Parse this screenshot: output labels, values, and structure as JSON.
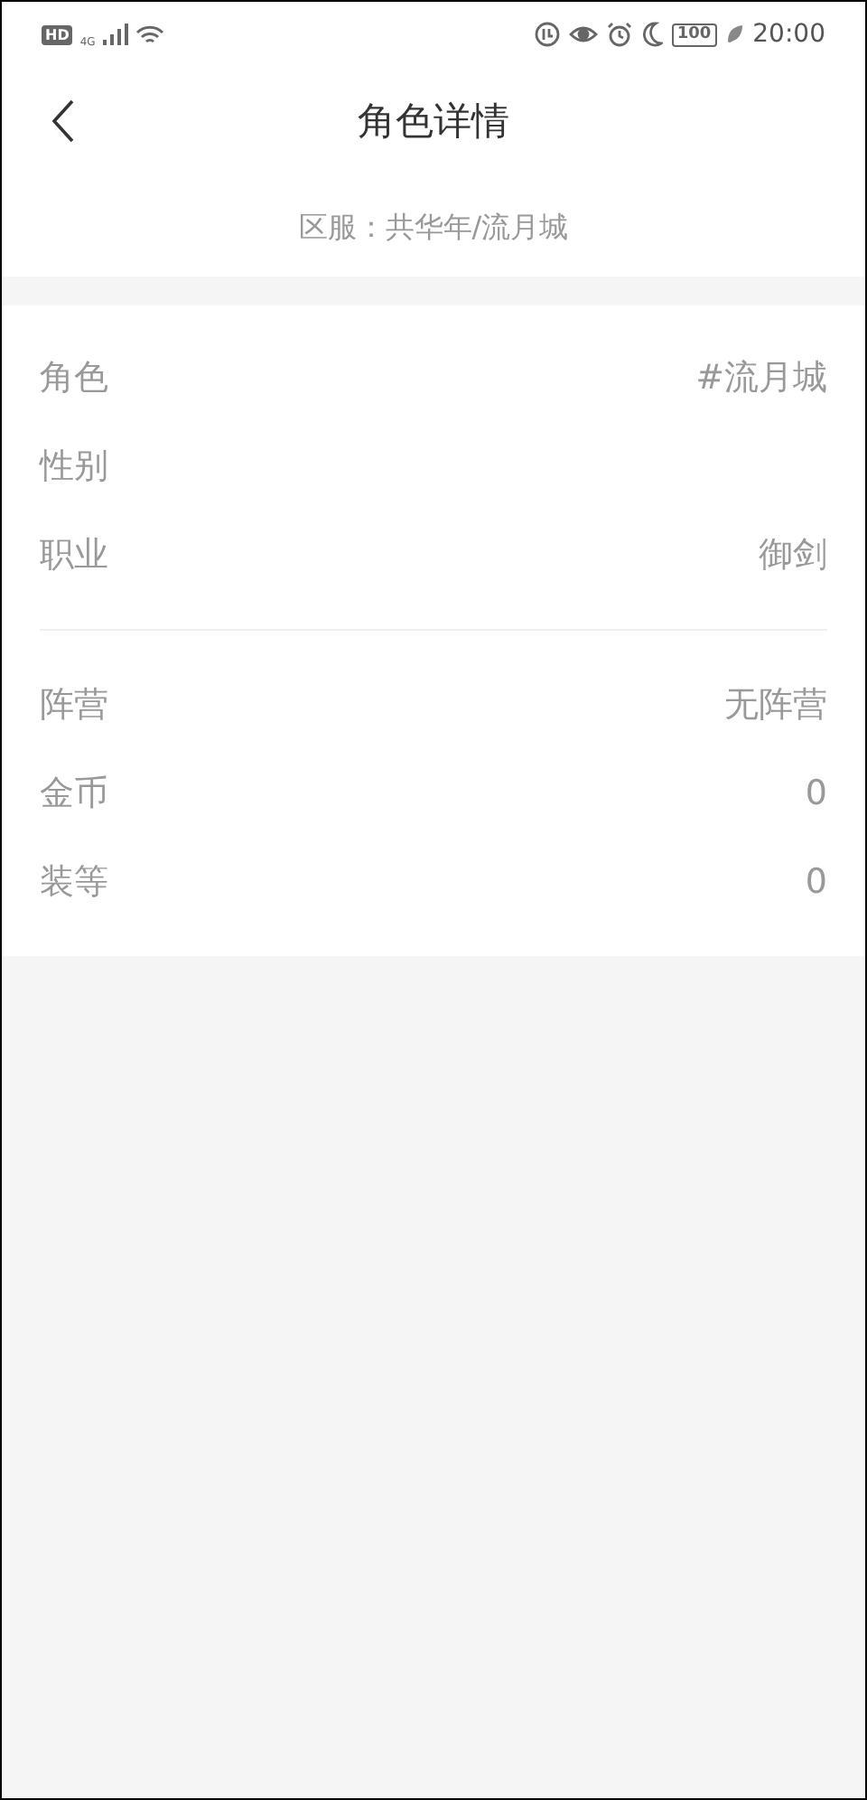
{
  "status_bar": {
    "hd": "HD",
    "network": "4G",
    "battery": "100",
    "time": "20:00"
  },
  "header": {
    "title": "角色详情"
  },
  "server": "区服：共华年/流月城",
  "groups": [
    [
      {
        "label": "角色",
        "value": "#流月城"
      },
      {
        "label": "性别"
      },
      {
        "label": "职业",
        "value": "御剑"
      }
    ],
    [
      {
        "label": "阵营",
        "value": "无阵营"
      },
      {
        "label": "金币",
        "value": "0"
      },
      {
        "label": "装等",
        "value": "0"
      }
    ]
  ]
}
